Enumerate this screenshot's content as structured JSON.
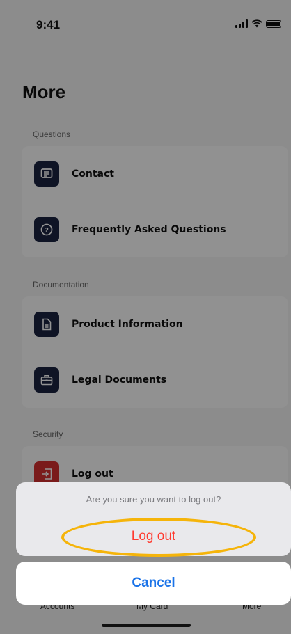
{
  "status_bar": {
    "time": "9:41"
  },
  "page": {
    "title": "More"
  },
  "sections": [
    {
      "label": "Questions",
      "items": [
        {
          "label": "Contact",
          "icon": "chat-icon"
        },
        {
          "label": "Frequently Asked Questions",
          "icon": "question-circle-icon"
        }
      ]
    },
    {
      "label": "Documentation",
      "items": [
        {
          "label": "Product Information",
          "icon": "document-icon"
        },
        {
          "label": "Legal Documents",
          "icon": "briefcase-icon"
        }
      ]
    },
    {
      "label": "Security",
      "items": [
        {
          "label": "Log out",
          "icon": "logout-icon"
        }
      ]
    }
  ],
  "tab_bar": {
    "items": [
      "Accounts",
      "My Card",
      "More"
    ]
  },
  "action_sheet": {
    "message": "Are you sure you want to log out?",
    "confirm_label": "Log out",
    "cancel_label": "Cancel"
  },
  "colors": {
    "icon_bg": "#1a2340",
    "logout_icon_bg": "#d32f2f",
    "destructive": "#ff3b30",
    "cancel": "#1a73e8",
    "highlight": "#f5b40a"
  }
}
